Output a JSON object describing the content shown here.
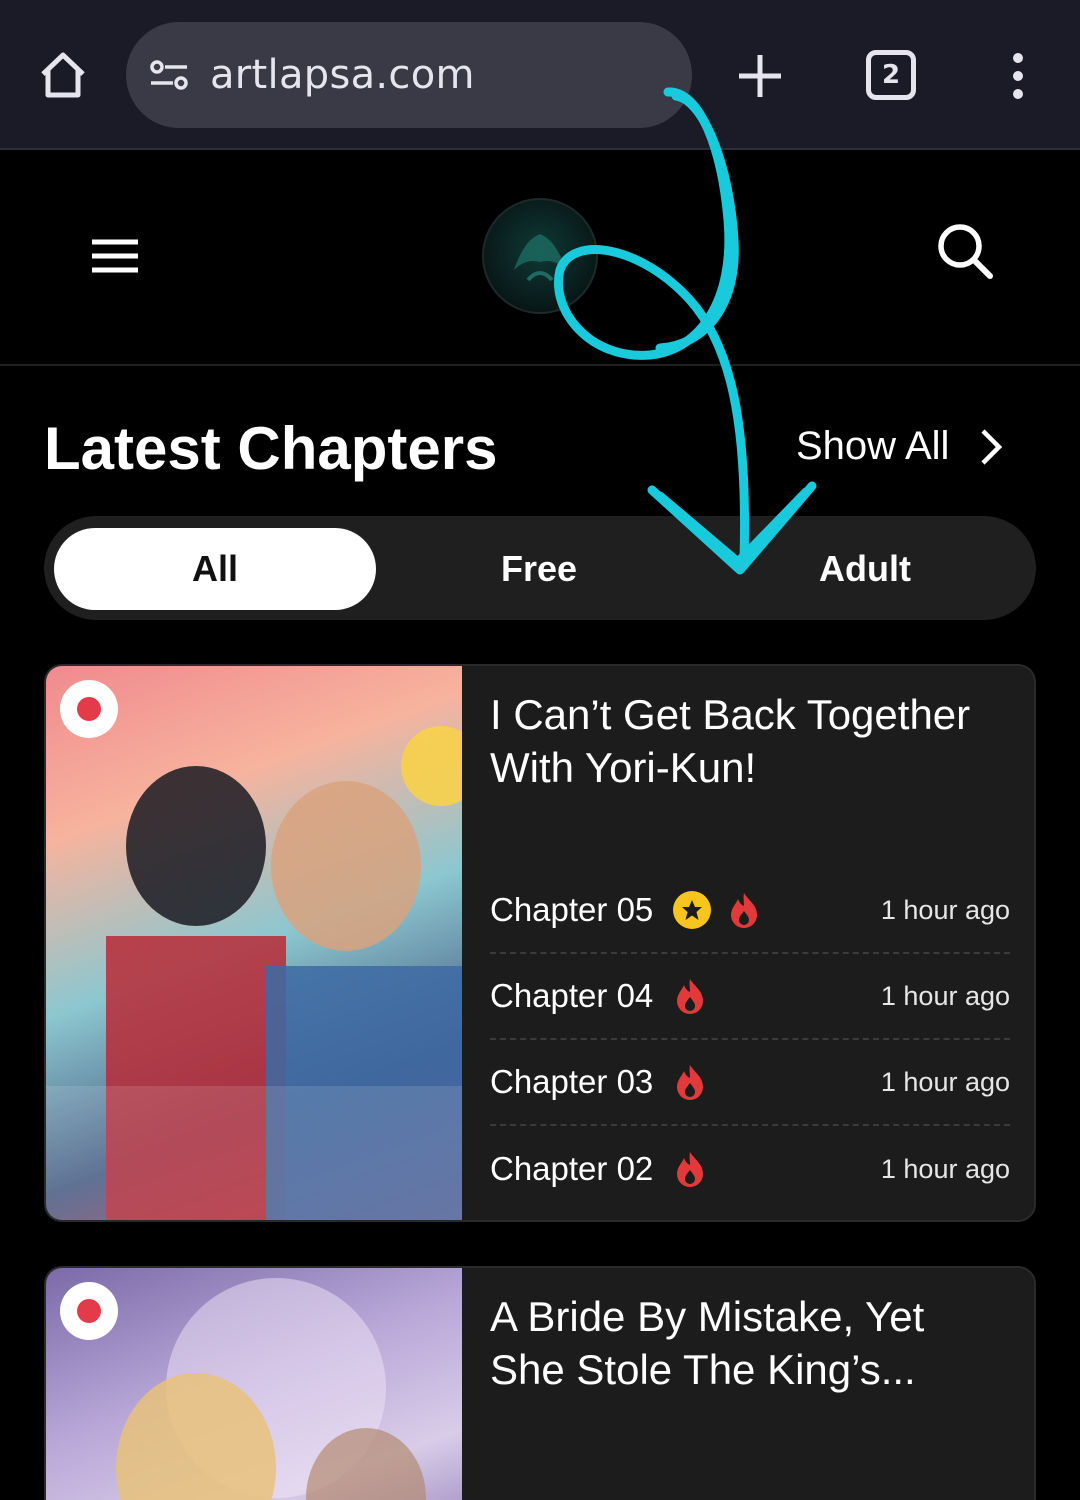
{
  "browser": {
    "url": "artlapsa.com",
    "tab_count": "2",
    "icons": [
      "home-icon",
      "site-info-icon",
      "plus-icon",
      "tabs-icon",
      "more-vert-icon"
    ]
  },
  "site_header": {
    "icons": [
      "hamburger-icon",
      "logo",
      "search-icon"
    ]
  },
  "section": {
    "title": "Latest Chapters",
    "show_all": "Show All"
  },
  "filters": {
    "tabs": [
      {
        "label": "All",
        "active": true
      },
      {
        "label": "Free",
        "active": false
      },
      {
        "label": "Adult",
        "active": false
      }
    ]
  },
  "cards": [
    {
      "title": "I Can’t Get Back Together With Yori-Kun!",
      "chapters": [
        {
          "name": "Chapter 05",
          "time": "1 hour ago",
          "star": true,
          "hot": true
        },
        {
          "name": "Chapter 04",
          "time": "1 hour ago",
          "star": false,
          "hot": true
        },
        {
          "name": "Chapter 03",
          "time": "1 hour ago",
          "star": false,
          "hot": true
        },
        {
          "name": "Chapter 02",
          "time": "1 hour ago",
          "star": false,
          "hot": true
        }
      ]
    },
    {
      "title": "A Bride By Mistake, Yet She Stole The King’s..."
    }
  ],
  "colors": {
    "accent_annotation": "#19c9dc",
    "star": "#f7c51e",
    "fire": "#e23a3a",
    "badge_dot": "#e33b4a"
  }
}
